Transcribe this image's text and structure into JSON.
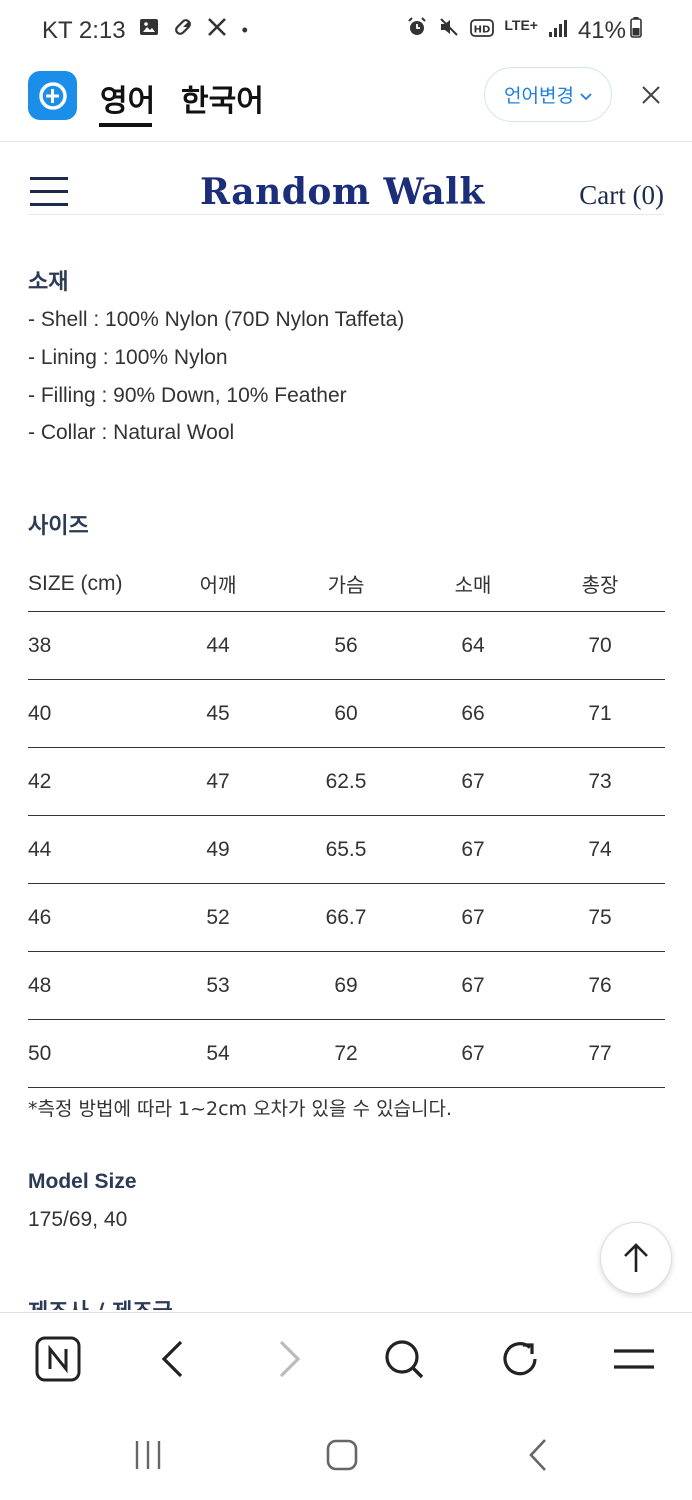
{
  "status_bar": {
    "carrier_time": "KT 2:13",
    "dot": "•",
    "network": "LTE+",
    "battery": "41%"
  },
  "translate_bar": {
    "tab_active": "영어",
    "tab_other": "한국어",
    "change_language": "언어변경"
  },
  "header": {
    "brand": "Random Walk",
    "cart": "Cart (0)"
  },
  "materials": {
    "title": "소재",
    "lines": [
      "- Shell : 100% Nylon (70D Nylon Taffeta)",
      "- Lining : 100% Nylon",
      "- Filling : 90% Down, 10% Feather",
      "- Collar : Natural Wool"
    ]
  },
  "size_chart": {
    "title": "사이즈",
    "headers": [
      "SIZE (cm)",
      "어깨",
      "가슴",
      "소매",
      "총장"
    ],
    "rows": [
      [
        "38",
        "44",
        "56",
        "64",
        "70"
      ],
      [
        "40",
        "45",
        "60",
        "66",
        "71"
      ],
      [
        "42",
        "47",
        "62.5",
        "67",
        "73"
      ],
      [
        "44",
        "49",
        "65.5",
        "67",
        "74"
      ],
      [
        "46",
        "52",
        "66.7",
        "67",
        "75"
      ],
      [
        "48",
        "53",
        "69",
        "67",
        "76"
      ],
      [
        "50",
        "54",
        "72",
        "67",
        "77"
      ]
    ],
    "note": "*측정 방법에 따라 1~2cm 오차가 있을 수 있습니다."
  },
  "model": {
    "title": "Model Size",
    "value": "175/69, 40"
  },
  "next_section": {
    "title": "제조사 / 제조국"
  },
  "colors": {
    "brand_navy": "#1c2e7a",
    "accent_blue": "#1a8ee8"
  }
}
